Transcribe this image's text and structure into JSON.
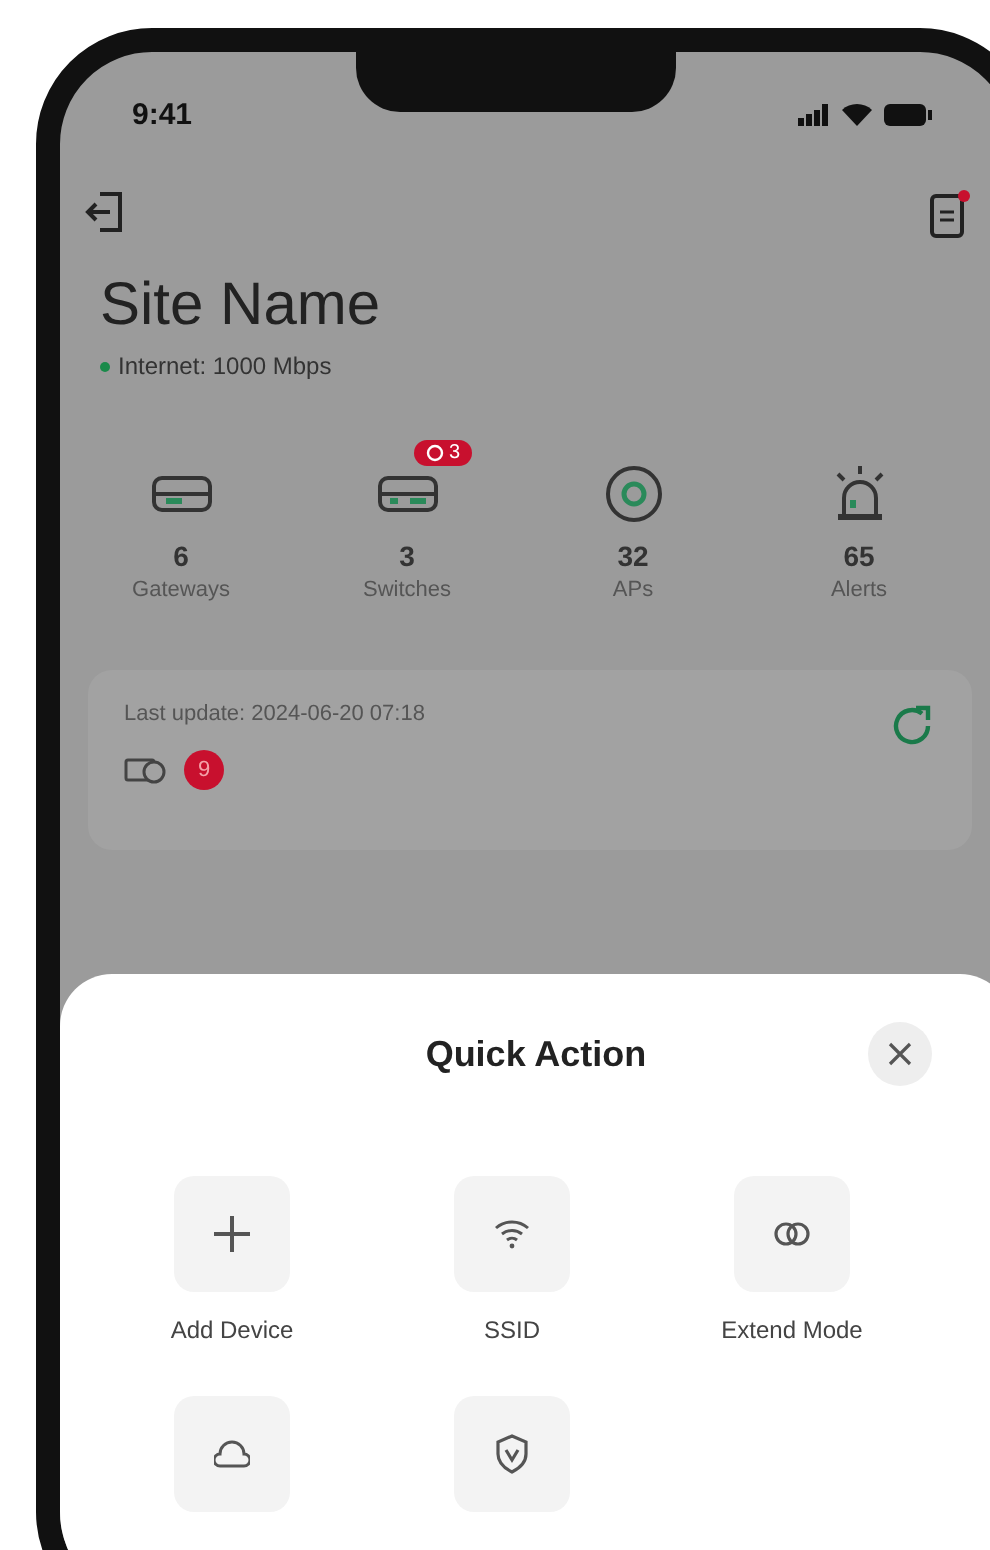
{
  "status_bar": {
    "time": "9:41"
  },
  "site": {
    "name": "Site Name",
    "internet": "Internet: 1000 Mbps",
    "online": true
  },
  "stats": [
    {
      "kind": "gateway",
      "value": "6",
      "label": "Gateways"
    },
    {
      "kind": "switch",
      "value": "3",
      "label": "Switches",
      "badge": "3"
    },
    {
      "kind": "ap",
      "value": "32",
      "label": "APs"
    },
    {
      "kind": "alert",
      "value": "65",
      "label": "Alerts"
    }
  ],
  "update_card": {
    "text": "Last update: 2024-06-20 07:18",
    "badge": "9"
  },
  "sheet": {
    "title": "Quick Action",
    "actions": [
      {
        "kind": "add",
        "label": "Add Device"
      },
      {
        "kind": "wifi",
        "label": "SSID"
      },
      {
        "kind": "link",
        "label": "Extend Mode"
      },
      {
        "kind": "cloud"
      },
      {
        "kind": "shield"
      }
    ]
  }
}
